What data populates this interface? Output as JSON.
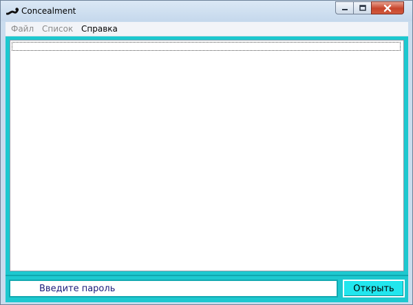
{
  "window": {
    "title": "Concealment",
    "icon": "snake-app-icon",
    "controls": {
      "minimize": "minimize-icon",
      "maximize": "maximize-icon",
      "close": "close-icon"
    }
  },
  "menu": {
    "items": [
      {
        "label": "Файл",
        "enabled": false
      },
      {
        "label": "Список",
        "enabled": false
      },
      {
        "label": "Справка",
        "enabled": true
      }
    ]
  },
  "editor": {
    "text": ""
  },
  "password": {
    "value": "",
    "placeholder": "Введите пароль"
  },
  "actions": {
    "open_label": "Открыть"
  },
  "colors": {
    "accent": "#1dc8cf",
    "button": "#22e6ee",
    "text_blue": "#1b1b7a"
  }
}
